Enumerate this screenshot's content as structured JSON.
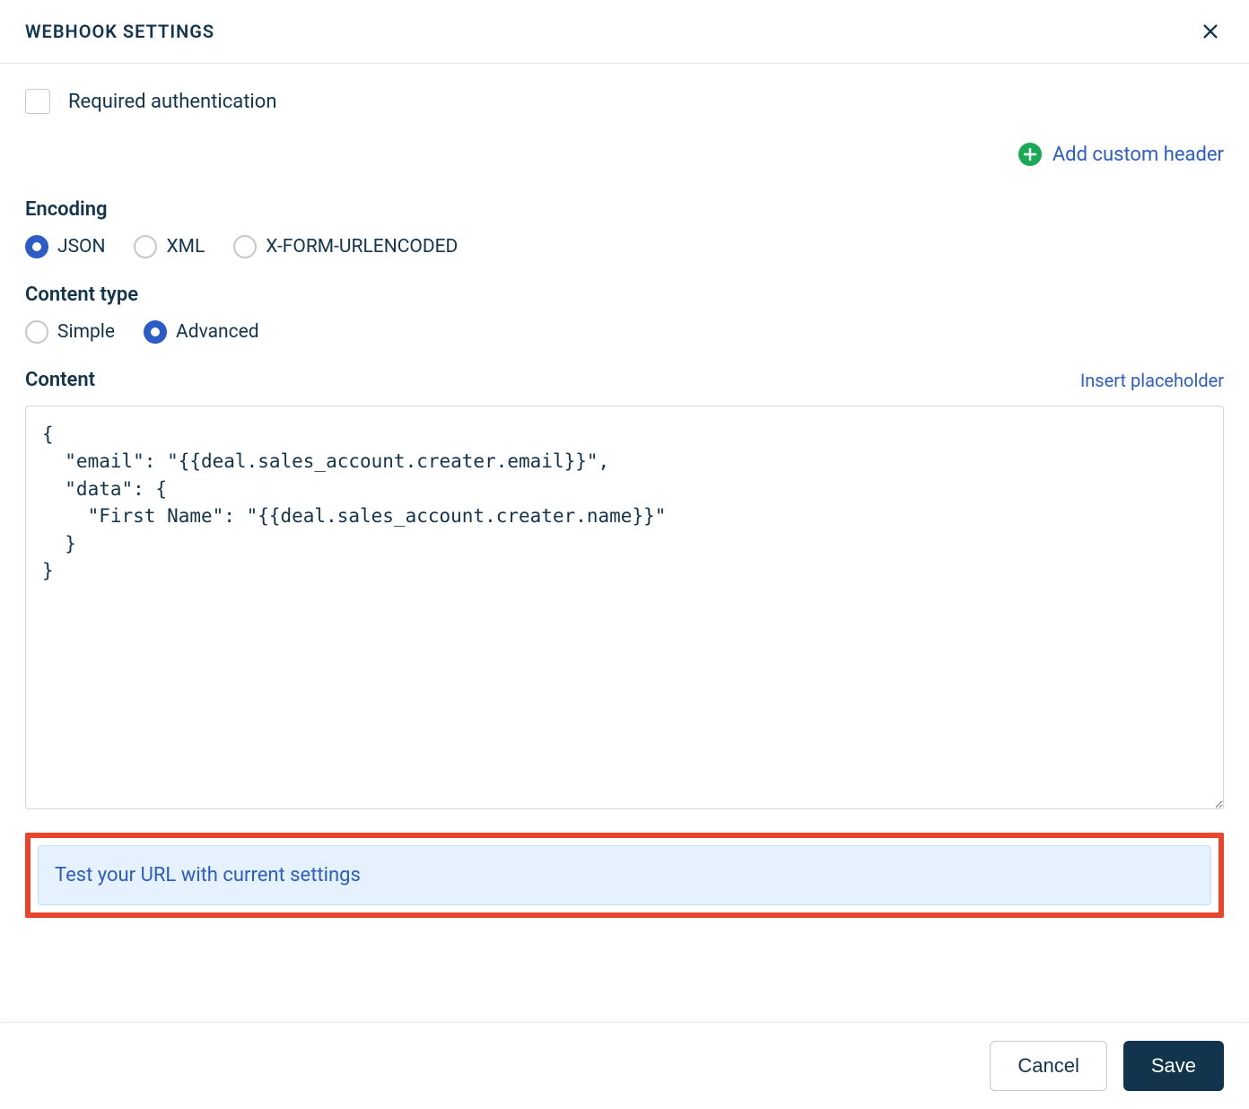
{
  "header": {
    "title": "WEBHOOK SETTINGS"
  },
  "auth": {
    "checkbox_label": "Required authentication"
  },
  "custom_header": {
    "link_text": "Add custom header"
  },
  "encoding": {
    "label": "Encoding",
    "options": {
      "json": "JSON",
      "xml": "XML",
      "xform": "X-FORM-URLENCODED"
    }
  },
  "content_type": {
    "label": "Content type",
    "options": {
      "simple": "Simple",
      "advanced": "Advanced"
    }
  },
  "content": {
    "label": "Content",
    "insert_link": "Insert placeholder",
    "body": "{\n  \"email\": \"{{deal.sales_account.creater.email}}\",\n  \"data\": {\n    \"First Name\": \"{{deal.sales_account.creater.name}}\"\n  }\n}"
  },
  "test": {
    "link_text": "Test your URL with current settings"
  },
  "footer": {
    "cancel": "Cancel",
    "save": "Save"
  }
}
